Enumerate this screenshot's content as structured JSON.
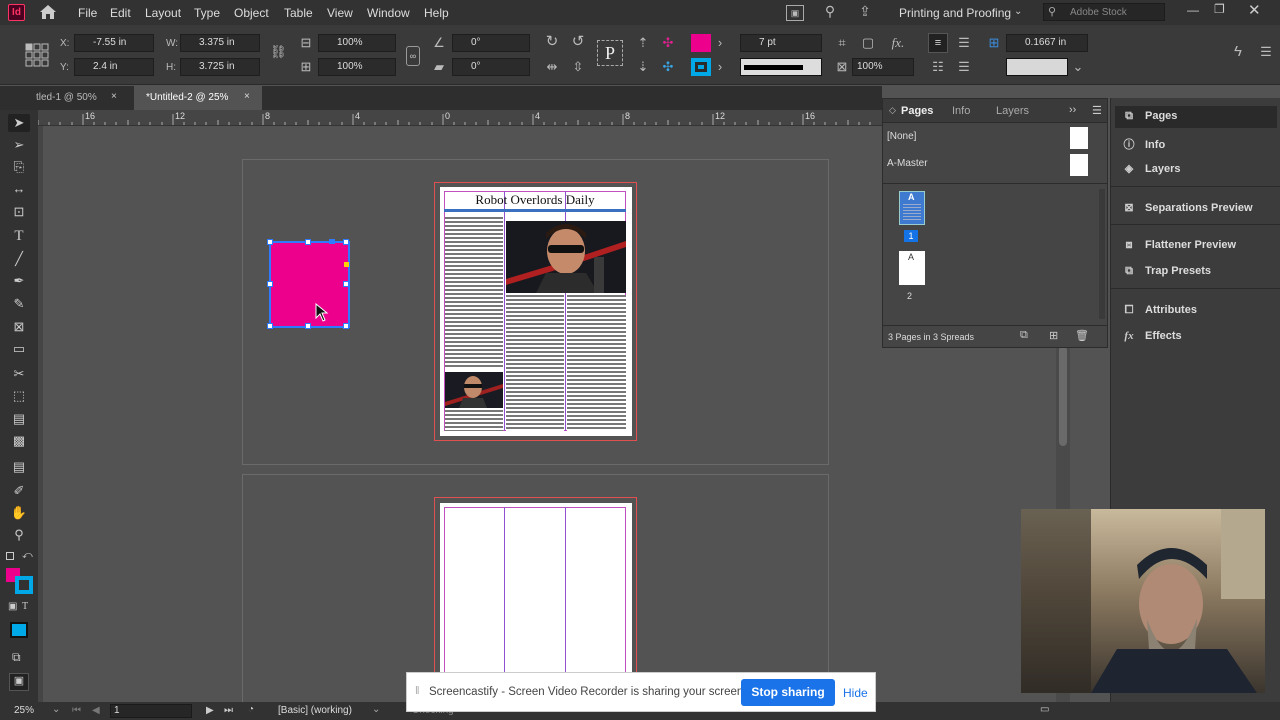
{
  "app": {
    "logo": "Id"
  },
  "menu": [
    "File",
    "Edit",
    "Layout",
    "Type",
    "Object",
    "Table",
    "View",
    "Window",
    "Help"
  ],
  "workspace": "Printing and Proofing",
  "search_placeholder": "Adobe Stock",
  "control": {
    "x_label": "X:",
    "x": "-7.55 in",
    "y_label": "Y:",
    "y": "2.4 in",
    "w_label": "W:",
    "w": "3.375 in",
    "h_label": "H:",
    "h": "3.725 in",
    "scale_x": "100%",
    "scale_y": "100%",
    "rotate": "0°",
    "shear": "0°",
    "stroke_weight": "7 pt",
    "opacity": "100%",
    "gutter": "0.1667 in"
  },
  "tabs": [
    {
      "label": "tled-1 @ 50%"
    },
    {
      "label": "*Untitled-2 @ 25%"
    }
  ],
  "ruler_ticks": [
    "16",
    "12",
    "8",
    "4",
    "0",
    "4",
    "8",
    "12",
    "16"
  ],
  "document": {
    "headline": "Robot Overlords Daily"
  },
  "pages_panel": {
    "tabs": [
      "Pages",
      "Info",
      "Layers"
    ],
    "masters": [
      "[None]",
      "A-Master"
    ],
    "pages": [
      {
        "master": "A",
        "number": "1"
      },
      {
        "master": "A",
        "number": "2"
      }
    ],
    "footer": "3 Pages in 3 Spreads"
  },
  "dock": [
    {
      "label": "Pages",
      "icon": "pages-icon"
    },
    {
      "label": "Info",
      "icon": "info-icon"
    },
    {
      "label": "Layers",
      "icon": "layers-icon"
    },
    {
      "label": "Separations Preview",
      "icon": "separations-icon"
    },
    {
      "label": "Flattener Preview",
      "icon": "flattener-icon"
    },
    {
      "label": "Trap Presets",
      "icon": "trap-icon"
    },
    {
      "label": "Attributes",
      "icon": "attributes-icon"
    },
    {
      "label": "Effects",
      "icon": "effects-icon"
    }
  ],
  "status": {
    "zoom": "25%",
    "page": "1",
    "preflight_profile": "[Basic] (working)",
    "preflight_state": "Checking"
  },
  "notification": {
    "text": "Screencastify - Screen Video Recorder is sharing your screen.",
    "stop": "Stop sharing",
    "hide": "Hide"
  },
  "colors": {
    "accent": "#1473e6",
    "selection": "#2f7bff",
    "magenta": "#ec008c",
    "cyan": "#00a8e8",
    "menubar": "#323232"
  }
}
